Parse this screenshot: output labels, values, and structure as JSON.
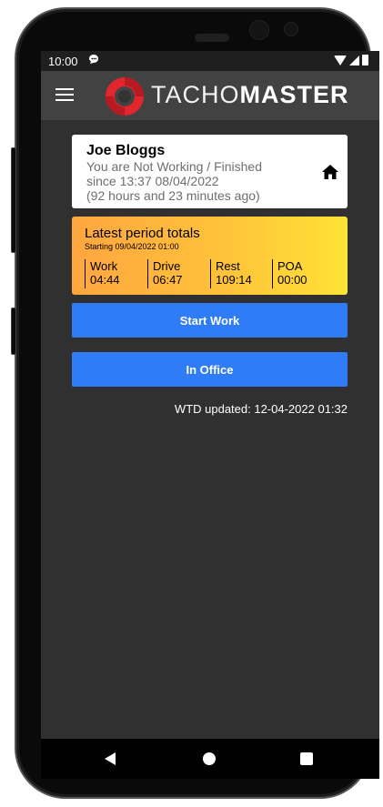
{
  "status_bar": {
    "time": "10:00"
  },
  "app_bar": {
    "logo_light": "TACHO",
    "logo_bold": "MASTER"
  },
  "driver": {
    "name": "Joe Bloggs",
    "status_line": "You are Not Working / Finished",
    "since_line": "since 13:37 08/04/2022",
    "ago_line": "(92 hours and 23 minutes ago)"
  },
  "totals": {
    "title": "Latest period totals",
    "subtitle": "Starting 09/04/2022 01:00",
    "items": [
      {
        "label": "Work",
        "value": "04:44"
      },
      {
        "label": "Drive",
        "value": "06:47"
      },
      {
        "label": "Rest",
        "value": "109:14"
      },
      {
        "label": "POA",
        "value": "00:00"
      }
    ]
  },
  "actions": {
    "start_work": "Start Work",
    "in_office": "In Office"
  },
  "wtd_updated": "WTD updated: 12-04-2022 01:32",
  "colors": {
    "brand_red": "#e3262d",
    "button_blue": "#2f7cf6",
    "screen_bg": "#303030",
    "app_bar_bg": "#424242"
  },
  "icons": {
    "menu": "menu-icon",
    "home": "home-icon",
    "logo": "tachomaster-logo",
    "notification": "chat-notification-icon",
    "wifi": "wifi-icon",
    "signal": "signal-icon",
    "battery": "battery-icon",
    "nav_back": "back-icon",
    "nav_home": "home-circle-icon",
    "nav_recent": "recent-apps-icon"
  }
}
